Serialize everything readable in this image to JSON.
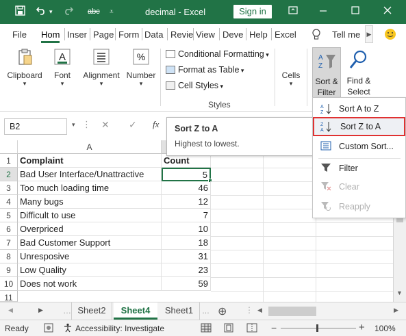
{
  "titlebar": {
    "title": "decimal  -  Excel",
    "signin": "Sign in",
    "save_icon": "save-icon",
    "undo_icon": "undo-icon",
    "redo_icon": "redo-icon",
    "spelling_label": "abc"
  },
  "tabs": [
    "File",
    "Hom",
    "Inser",
    "Page",
    "Form",
    "Data",
    "Revie",
    "View",
    "Deve",
    "Help",
    "Excel"
  ],
  "tellme": "Tell me",
  "ribbon": {
    "clipboard": "Clipboard",
    "font": "Font",
    "alignment": "Alignment",
    "number": "Number",
    "conditional_formatting": "Conditional Formatting",
    "format_as_table": "Format as Table",
    "cell_styles": "Cell Styles",
    "styles_group": "Styles",
    "cells": "Cells",
    "sort_filter_1": "Sort &",
    "sort_filter_2": "Filter",
    "find_select_1": "Find &",
    "find_select_2": "Select"
  },
  "namebox": "B2",
  "fx": "fx",
  "tooltip": {
    "title": "Sort Z to A",
    "desc": "Highest to lowest."
  },
  "dropdown": {
    "sort_az": "Sort A to Z",
    "sort_za": "Sort Z to A",
    "custom_sort": "Custom Sort...",
    "filter": "Filter",
    "clear": "Clear",
    "reapply": "Reapply"
  },
  "grid": {
    "col_a": "A",
    "rows": [
      "1",
      "2",
      "3",
      "4",
      "5",
      "6",
      "7",
      "8",
      "9",
      "10",
      "11"
    ],
    "header": {
      "a": "Complaint",
      "b": "Count"
    },
    "data": [
      {
        "a": "Bad User Interface/Unattractive",
        "b": "5"
      },
      {
        "a": "Too much loading time",
        "b": "46"
      },
      {
        "a": "Many bugs",
        "b": "12"
      },
      {
        "a": "Difficult to use",
        "b": "7"
      },
      {
        "a": "Overpriced",
        "b": "10"
      },
      {
        "a": "Bad Customer Support",
        "b": "18"
      },
      {
        "a": "Unresposive",
        "b": "31"
      },
      {
        "a": "Low Quality",
        "b": "23"
      },
      {
        "a": "Does not work",
        "b": "59"
      }
    ]
  },
  "sheets": [
    "Sheet2",
    "Sheet4",
    "Sheet1"
  ],
  "status": {
    "ready": "Ready",
    "accessibility": "Accessibility: Investigate",
    "zoom": "100%"
  },
  "colors": {
    "excel_green": "#217346",
    "highlight_red": "#e03131"
  }
}
